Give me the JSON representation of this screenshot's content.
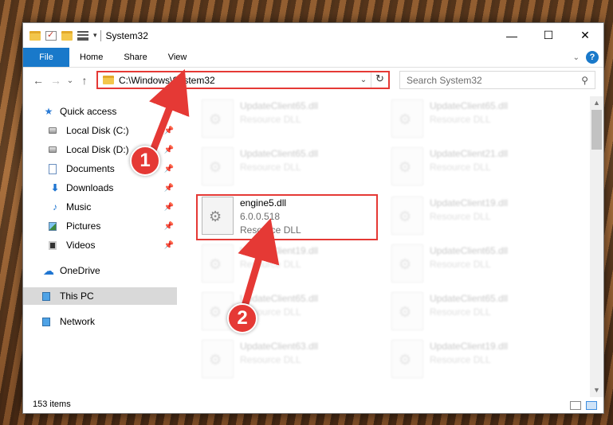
{
  "window": {
    "title": "System32",
    "controls": {
      "minimize": "—",
      "maximize": "☐",
      "close": "✕"
    }
  },
  "ribbon": {
    "tabs": [
      "File",
      "Home",
      "Share",
      "View"
    ],
    "help": "?"
  },
  "nav": {
    "back": "←",
    "forward": "→",
    "recent": "⌄",
    "up": "↑",
    "address": "C:\\Windows\\System32",
    "refresh": "↻",
    "search_placeholder": "Search System32"
  },
  "sidebar": {
    "items": [
      {
        "label": "Quick access",
        "icon": "star-icon"
      },
      {
        "label": "Local Disk (C:)",
        "icon": "drive-icon",
        "pinned": true
      },
      {
        "label": "Local Disk (D:)",
        "icon": "drive-icon",
        "pinned": true
      },
      {
        "label": "Documents",
        "icon": "documents-icon",
        "pinned": true
      },
      {
        "label": "Downloads",
        "icon": "downloads-icon",
        "pinned": true
      },
      {
        "label": "Music",
        "icon": "music-icon",
        "pinned": true
      },
      {
        "label": "Pictures",
        "icon": "pictures-icon",
        "pinned": true
      },
      {
        "label": "Videos",
        "icon": "videos-icon",
        "pinned": true
      },
      {
        "label": "OneDrive",
        "icon": "onedrive-icon"
      },
      {
        "label": "This PC",
        "icon": "pc-icon",
        "selected": true
      },
      {
        "label": "Network",
        "icon": "network-icon"
      }
    ]
  },
  "files": [
    {
      "name": "UpdateClient65.dll",
      "meta": "Resource DLL",
      "blurred": true
    },
    {
      "name": "UpdateClient65.dll",
      "meta": "Resource DLL",
      "blurred": true
    },
    {
      "name": "UpdateClient65.dll",
      "meta": "Resource DLL",
      "blurred": true
    },
    {
      "name": "UpdateClient21.dll",
      "meta": "Resource DLL",
      "blurred": true
    },
    {
      "name": "engine5.dll",
      "version": "6.0.0.518",
      "meta": "Resource DLL",
      "blurred": false
    },
    {
      "name": "UpdateClient19.dll",
      "meta": "Resource DLL",
      "blurred": true
    },
    {
      "name": "UpdateClient19.dll",
      "meta": "Resource DLL",
      "blurred": true
    },
    {
      "name": "UpdateClient65.dll",
      "meta": "Resource DLL",
      "blurred": true
    },
    {
      "name": "UpdateClient65.dll",
      "meta": "Resource DLL",
      "blurred": true
    },
    {
      "name": "UpdateClient65.dll",
      "meta": "Resource DLL",
      "blurred": true
    },
    {
      "name": "UpdateClient63.dll",
      "meta": "Resource DLL",
      "blurred": true
    },
    {
      "name": "UpdateClient19.dll",
      "meta": "Resource DLL",
      "blurred": true
    }
  ],
  "status": {
    "count": "153 items"
  },
  "annotations": {
    "step1": "1",
    "step2": "2"
  },
  "colors": {
    "accent": "#1979ca",
    "highlight": "#e53935"
  }
}
